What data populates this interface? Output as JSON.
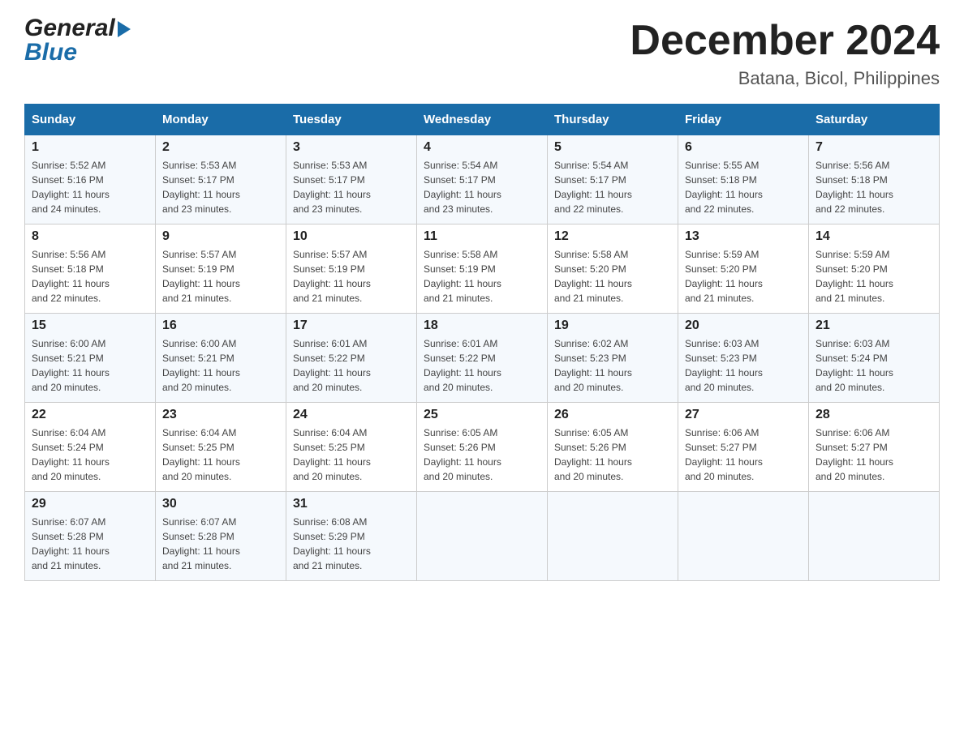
{
  "header": {
    "logo_general": "General",
    "logo_blue": "Blue",
    "month": "December 2024",
    "location": "Batana, Bicol, Philippines"
  },
  "weekdays": [
    "Sunday",
    "Monday",
    "Tuesday",
    "Wednesday",
    "Thursday",
    "Friday",
    "Saturday"
  ],
  "weeks": [
    [
      {
        "day": "1",
        "sunrise": "5:52 AM",
        "sunset": "5:16 PM",
        "daylight": "11 hours and 24 minutes."
      },
      {
        "day": "2",
        "sunrise": "5:53 AM",
        "sunset": "5:17 PM",
        "daylight": "11 hours and 23 minutes."
      },
      {
        "day": "3",
        "sunrise": "5:53 AM",
        "sunset": "5:17 PM",
        "daylight": "11 hours and 23 minutes."
      },
      {
        "day": "4",
        "sunrise": "5:54 AM",
        "sunset": "5:17 PM",
        "daylight": "11 hours and 23 minutes."
      },
      {
        "day": "5",
        "sunrise": "5:54 AM",
        "sunset": "5:17 PM",
        "daylight": "11 hours and 22 minutes."
      },
      {
        "day": "6",
        "sunrise": "5:55 AM",
        "sunset": "5:18 PM",
        "daylight": "11 hours and 22 minutes."
      },
      {
        "day": "7",
        "sunrise": "5:56 AM",
        "sunset": "5:18 PM",
        "daylight": "11 hours and 22 minutes."
      }
    ],
    [
      {
        "day": "8",
        "sunrise": "5:56 AM",
        "sunset": "5:18 PM",
        "daylight": "11 hours and 22 minutes."
      },
      {
        "day": "9",
        "sunrise": "5:57 AM",
        "sunset": "5:19 PM",
        "daylight": "11 hours and 21 minutes."
      },
      {
        "day": "10",
        "sunrise": "5:57 AM",
        "sunset": "5:19 PM",
        "daylight": "11 hours and 21 minutes."
      },
      {
        "day": "11",
        "sunrise": "5:58 AM",
        "sunset": "5:19 PM",
        "daylight": "11 hours and 21 minutes."
      },
      {
        "day": "12",
        "sunrise": "5:58 AM",
        "sunset": "5:20 PM",
        "daylight": "11 hours and 21 minutes."
      },
      {
        "day": "13",
        "sunrise": "5:59 AM",
        "sunset": "5:20 PM",
        "daylight": "11 hours and 21 minutes."
      },
      {
        "day": "14",
        "sunrise": "5:59 AM",
        "sunset": "5:20 PM",
        "daylight": "11 hours and 21 minutes."
      }
    ],
    [
      {
        "day": "15",
        "sunrise": "6:00 AM",
        "sunset": "5:21 PM",
        "daylight": "11 hours and 20 minutes."
      },
      {
        "day": "16",
        "sunrise": "6:00 AM",
        "sunset": "5:21 PM",
        "daylight": "11 hours and 20 minutes."
      },
      {
        "day": "17",
        "sunrise": "6:01 AM",
        "sunset": "5:22 PM",
        "daylight": "11 hours and 20 minutes."
      },
      {
        "day": "18",
        "sunrise": "6:01 AM",
        "sunset": "5:22 PM",
        "daylight": "11 hours and 20 minutes."
      },
      {
        "day": "19",
        "sunrise": "6:02 AM",
        "sunset": "5:23 PM",
        "daylight": "11 hours and 20 minutes."
      },
      {
        "day": "20",
        "sunrise": "6:03 AM",
        "sunset": "5:23 PM",
        "daylight": "11 hours and 20 minutes."
      },
      {
        "day": "21",
        "sunrise": "6:03 AM",
        "sunset": "5:24 PM",
        "daylight": "11 hours and 20 minutes."
      }
    ],
    [
      {
        "day": "22",
        "sunrise": "6:04 AM",
        "sunset": "5:24 PM",
        "daylight": "11 hours and 20 minutes."
      },
      {
        "day": "23",
        "sunrise": "6:04 AM",
        "sunset": "5:25 PM",
        "daylight": "11 hours and 20 minutes."
      },
      {
        "day": "24",
        "sunrise": "6:04 AM",
        "sunset": "5:25 PM",
        "daylight": "11 hours and 20 minutes."
      },
      {
        "day": "25",
        "sunrise": "6:05 AM",
        "sunset": "5:26 PM",
        "daylight": "11 hours and 20 minutes."
      },
      {
        "day": "26",
        "sunrise": "6:05 AM",
        "sunset": "5:26 PM",
        "daylight": "11 hours and 20 minutes."
      },
      {
        "day": "27",
        "sunrise": "6:06 AM",
        "sunset": "5:27 PM",
        "daylight": "11 hours and 20 minutes."
      },
      {
        "day": "28",
        "sunrise": "6:06 AM",
        "sunset": "5:27 PM",
        "daylight": "11 hours and 20 minutes."
      }
    ],
    [
      {
        "day": "29",
        "sunrise": "6:07 AM",
        "sunset": "5:28 PM",
        "daylight": "11 hours and 21 minutes."
      },
      {
        "day": "30",
        "sunrise": "6:07 AM",
        "sunset": "5:28 PM",
        "daylight": "11 hours and 21 minutes."
      },
      {
        "day": "31",
        "sunrise": "6:08 AM",
        "sunset": "5:29 PM",
        "daylight": "11 hours and 21 minutes."
      },
      null,
      null,
      null,
      null
    ]
  ],
  "labels": {
    "sunrise": "Sunrise:",
    "sunset": "Sunset:",
    "daylight": "Daylight:"
  }
}
